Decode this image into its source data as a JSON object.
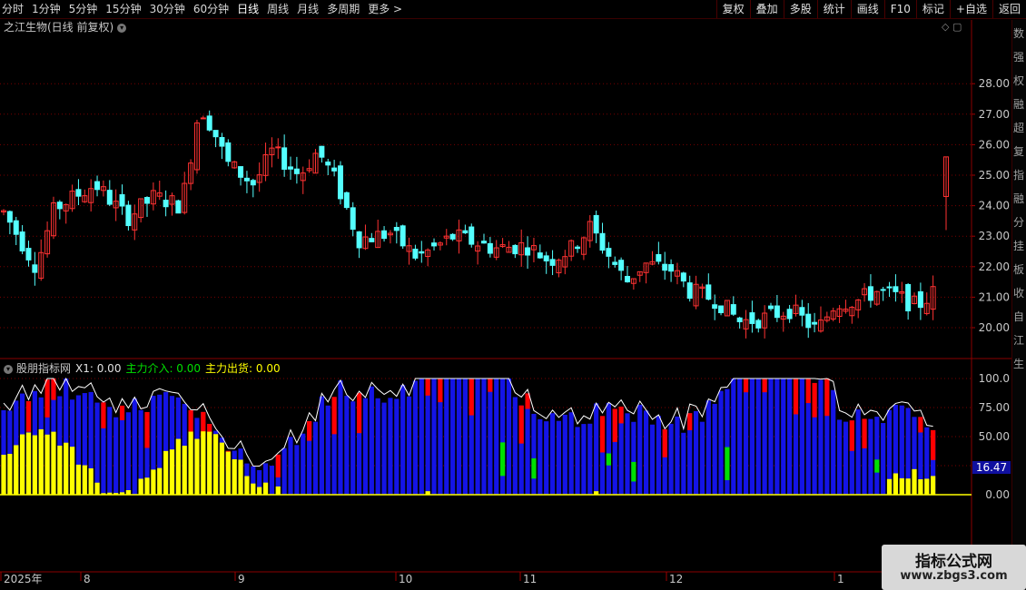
{
  "toolbar": {
    "periods": [
      "分时",
      "1分钟",
      "5分钟",
      "15分钟",
      "30分钟",
      "60分钟",
      "日线",
      "周线",
      "月线",
      "多周期",
      "更多 >"
    ],
    "active_period": "日线",
    "actions": [
      "复权",
      "叠加",
      "多股",
      "统计",
      "画线",
      "F10",
      "标记",
      "+自选",
      "返回"
    ]
  },
  "main_chart": {
    "title": "之江生物(日线 前复权)",
    "price_ticks": [
      "28.00",
      "27.00",
      "26.00",
      "25.00",
      "24.00",
      "23.00",
      "22.00",
      "21.00",
      "20.00"
    ]
  },
  "indicator": {
    "name": "股朋指标网",
    "x1_label": "X1: 0.00",
    "zl_in_label": "主力介入: 0.00",
    "zl_out_label": "主力出货: 0.00",
    "ticks": [
      "100.0",
      "75.00",
      "50.00",
      "25.00",
      "0.00"
    ],
    "current_value": "16.47"
  },
  "time_axis": [
    "2025年",
    "8",
    "9",
    "10",
    "11",
    "12",
    "1"
  ],
  "right_strip_labels": [
    "数",
    "强",
    "权",
    "融",
    "超",
    "复",
    "指",
    "融",
    "分",
    "挂",
    "板",
    "收",
    "自",
    "江",
    "生"
  ],
  "watermark": {
    "line1": "指标公式网",
    "line2": "www.zbgs3.com"
  },
  "colors": {
    "up": "#ff3232",
    "down": "#54ffff",
    "blue": "#1414e6",
    "red": "#ff0000",
    "yellow": "#ffff00",
    "green": "#00e000",
    "grid": "#780000"
  }
}
